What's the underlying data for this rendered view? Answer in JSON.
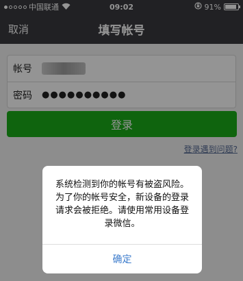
{
  "status_bar": {
    "carrier": "中国联通",
    "time": "09:02",
    "battery": "91%",
    "battery_level": 0.91,
    "wifi_icon": "wifi-icon"
  },
  "nav": {
    "cancel_label": "取消",
    "title": "填写帐号"
  },
  "form": {
    "account_label": "帐号",
    "password_label": "密码",
    "password_value": "●●●●●●●●●●"
  },
  "login_button": "登录",
  "help_link": "登录遇到问题?",
  "dialog": {
    "message": "系统检测到你的帐号有被盗风险。为了你的帐号安全，新设备的登录请求会被拒绝。请使用常用设备登录微信。",
    "confirm_label": "确定"
  },
  "colors": {
    "nav_background": "#393a3f",
    "primary_green": "#1aad19",
    "link_blue": "#576b95",
    "dialog_button": "#3d7ccc"
  }
}
